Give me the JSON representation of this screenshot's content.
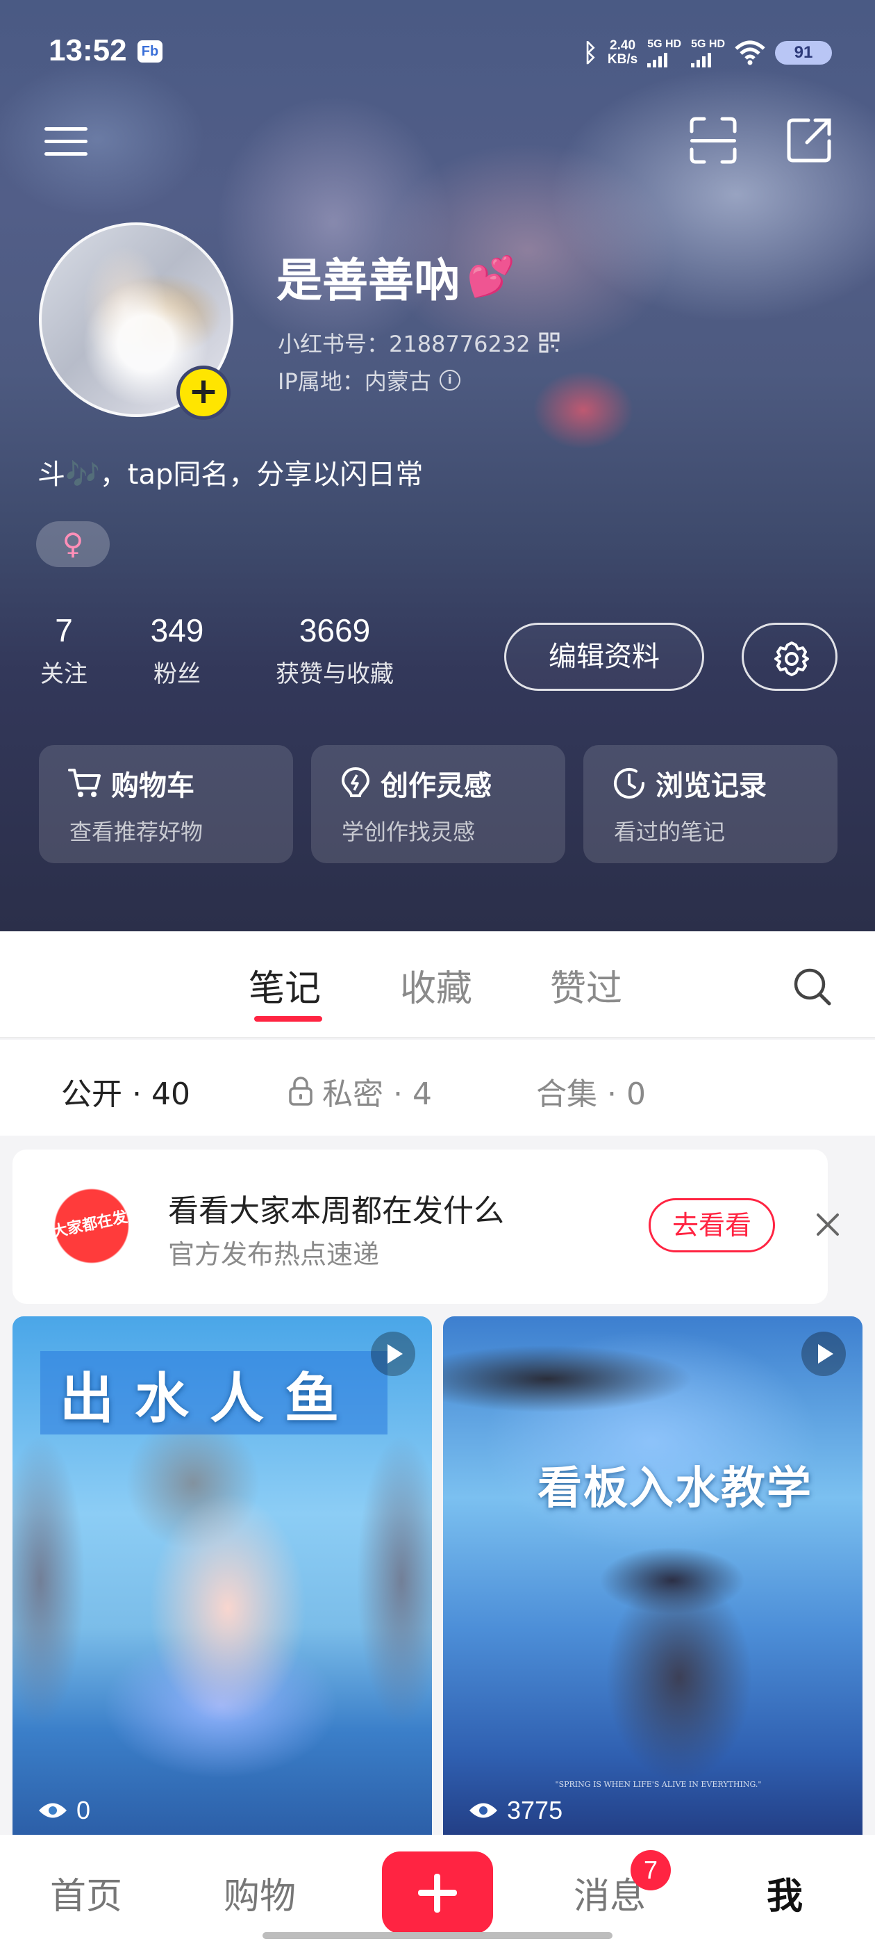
{
  "status_bar": {
    "time": "13:52",
    "app_badge": "Fb",
    "net_speed_value": "2.40",
    "net_speed_unit": "KB/s",
    "sim1": "5G HD",
    "sim2": "5G HD",
    "battery": "91"
  },
  "profile": {
    "nickname": "是善善吶",
    "nickname_emoji": "💕",
    "red_id": "小红书号：2188776232",
    "ip_location": "IP属地：内蒙古",
    "bio": "斗🎶，tap同名，分享以闪日常",
    "gender_symbol": "♀"
  },
  "stats": [
    {
      "value": "7",
      "label": "关注"
    },
    {
      "value": "349",
      "label": "粉丝"
    },
    {
      "value": "3669",
      "label": "获赞与收藏"
    }
  ],
  "actions": {
    "edit_profile": "编辑资料"
  },
  "shortcut_cards": [
    {
      "title": "购物车",
      "subtitle": "查看推荐好物",
      "icon": "cart-icon"
    },
    {
      "title": "创作灵感",
      "subtitle": "学创作找灵感",
      "icon": "bulb-icon"
    },
    {
      "title": "浏览记录",
      "subtitle": "看过的笔记",
      "icon": "clock-icon"
    }
  ],
  "tabs": [
    "笔记",
    "收藏",
    "赞过"
  ],
  "active_tab": "笔记",
  "subtabs": [
    {
      "label": "公开 · 40"
    },
    {
      "label": "私密 · 4"
    },
    {
      "label": "合集 · 0"
    }
  ],
  "promo": {
    "thumb_text": "大家都在发",
    "title": "看看大家本周都在发什么",
    "subtitle": "官方发布热点速递",
    "button": "去看看"
  },
  "notes": [
    {
      "title": "出水人鱼",
      "views": "0",
      "type": "video"
    },
    {
      "title": "看板入水教学",
      "views": "3775",
      "type": "video",
      "quote": "\"SPRING IS WHEN LIFE'S ALIVE IN EVERYTHING.\""
    }
  ],
  "bottom_nav": {
    "home": "首页",
    "shop": "购物",
    "messages": "消息",
    "messages_badge": "7",
    "me": "我"
  },
  "colors": {
    "accent": "#ff2442",
    "header_bg": "#3e4a6c",
    "avatar_add": "#ffe500"
  }
}
